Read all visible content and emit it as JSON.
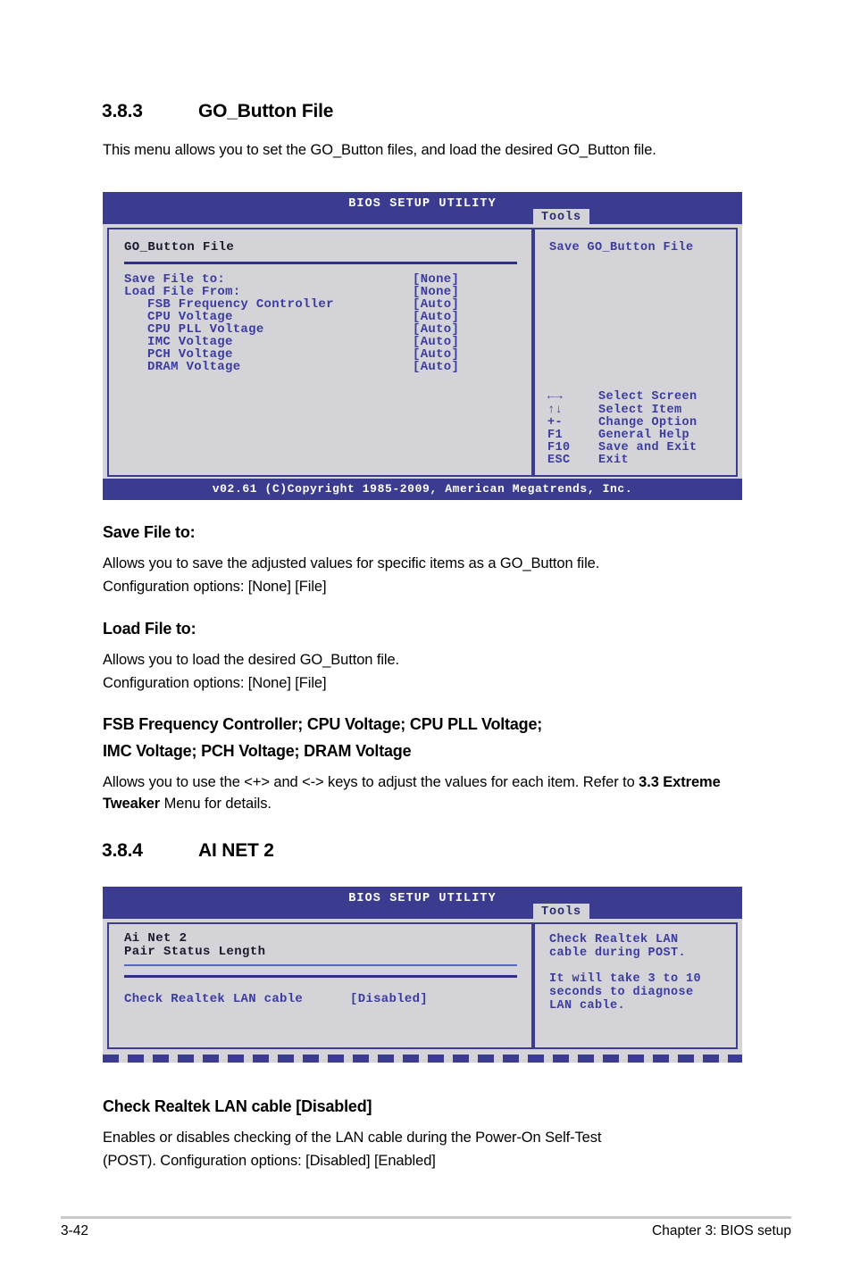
{
  "sections": {
    "go_button": {
      "number": "3.8.3",
      "title": "GO_Button File",
      "intro": "This menu allows you to set the GO_Button files, and load the desired GO_Button file."
    },
    "ai_net2": {
      "number": "3.8.4",
      "title": "AI NET 2"
    }
  },
  "bios_screen_1": {
    "title": "BIOS SETUP UTILITY",
    "tab": "Tools",
    "panel_title": "GO_Button File",
    "items": [
      {
        "label": "Save File to:",
        "value": "[None]",
        "indent": 0
      },
      {
        "label": "Load File From:",
        "value": "[None]",
        "indent": 0
      },
      {
        "label": "FSB Frequency Controller",
        "value": "[Auto]",
        "indent": 1
      },
      {
        "label": "CPU Voltage",
        "value": "[Auto]",
        "indent": 1
      },
      {
        "label": "CPU PLL Voltage",
        "value": "[Auto]",
        "indent": 1
      },
      {
        "label": "IMC Voltage",
        "value": "[Auto]",
        "indent": 1
      },
      {
        "label": "PCH Voltage",
        "value": "[Auto]",
        "indent": 1
      },
      {
        "label": "DRAM Voltage",
        "value": "[Auto]",
        "indent": 1
      }
    ],
    "help_title": "Save GO_Button File",
    "legend": [
      {
        "key": "←→",
        "desc": "Select Screen"
      },
      {
        "key": "↑↓",
        "desc": "Select Item"
      },
      {
        "key": "+-",
        "desc": "Change Option"
      },
      {
        "key": "F1",
        "desc": "General Help"
      },
      {
        "key": "F10",
        "desc": "Save and Exit"
      },
      {
        "key": "ESC",
        "desc": "Exit"
      }
    ],
    "footer": "v02.61 (C)Copyright 1985-2009, American Megatrends, Inc."
  },
  "bios_screen_2": {
    "title": "BIOS SETUP UTILITY",
    "tab": "Tools",
    "panel_title": "Ai Net 2",
    "table_headers": "Pair   Status   Length",
    "item_label": "Check Realtek LAN cable",
    "item_value": "[Disabled]",
    "help_lines": [
      "Check Realtek LAN",
      "cable during POST.",
      "",
      "It will take 3 to 10",
      "seconds to diagnose",
      "LAN cable."
    ]
  },
  "descriptions": {
    "save_file": {
      "heading": "Save File to:",
      "line1": "Allows you to save the adjusted values for specific items as a GO_Button file.",
      "line2": "Configuration options: [None] [File]"
    },
    "load_file": {
      "heading": "Load File to:",
      "line1": "Allows you to load the desired GO_Button file.",
      "line2": "Configuration options: [None] [File]"
    },
    "voltages": {
      "heading_line1": "FSB Frequency Controller; CPU Voltage; CPU PLL Voltage;",
      "heading_line2": "IMC Voltage; PCH Voltage; DRAM Voltage",
      "body_pre": "Allows you to use the <+> and <-> keys to adjust the values for each item. Refer to ",
      "body_bold": "3.3 Extreme Tweaker",
      "body_post": " Menu for details."
    },
    "realtek": {
      "heading": "Check Realtek LAN cable [Disabled]",
      "line1": "Enables or disables checking of the LAN cable during the Power-On Self-Test",
      "line2": "(POST). Configuration options: [Disabled] [Enabled]"
    }
  },
  "page_footer": {
    "page_number": "3-42",
    "chapter": "Chapter 3: BIOS setup"
  },
  "colors": {
    "header_blue": "#3b3b8f",
    "panel_gray": "#d4d4d8",
    "item_blue": "#3b3ba0"
  }
}
